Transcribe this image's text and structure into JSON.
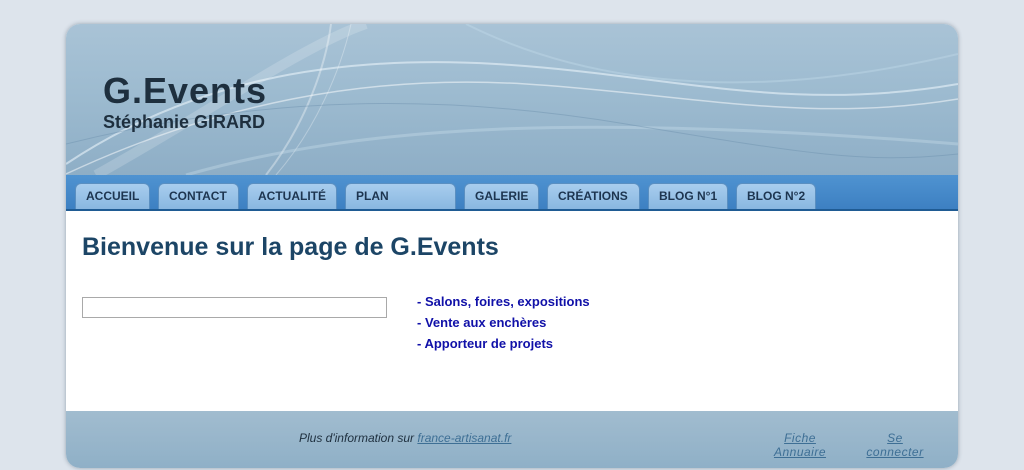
{
  "header": {
    "title": "G.Events",
    "subtitle": "Stéphanie GIRARD"
  },
  "nav": {
    "tabs": [
      {
        "label": "ACCUEIL"
      },
      {
        "label": "CONTACT"
      },
      {
        "label": "ACTUALITÉ"
      },
      {
        "label": "PLAN"
      },
      {
        "label": "GALERIE"
      },
      {
        "label": "CRÉATIONS"
      },
      {
        "label": "BLOG N°1"
      },
      {
        "label": "BLOG N°2"
      }
    ]
  },
  "main": {
    "heading": "Bienvenue sur la page de G.Events",
    "search_value": "",
    "services": [
      "- Salons, foires, expositions",
      "- Vente aux enchères",
      "- Apporteur de projets"
    ]
  },
  "footer": {
    "info_text": "Plus d'information sur",
    "info_link": "france-artisanat.fr",
    "annuaire_line1": "Fiche",
    "annuaire_line2": "Annuaire",
    "connect_line1": "Se",
    "connect_line2": "connecter"
  },
  "colors": {
    "header_bg": "#9dbbd0",
    "nav_bg": "#3d80c2",
    "tab_bg": "#a8cdee",
    "heading": "#1c4566",
    "service_link": "#1010a8",
    "footer_link": "#3e6f95"
  }
}
